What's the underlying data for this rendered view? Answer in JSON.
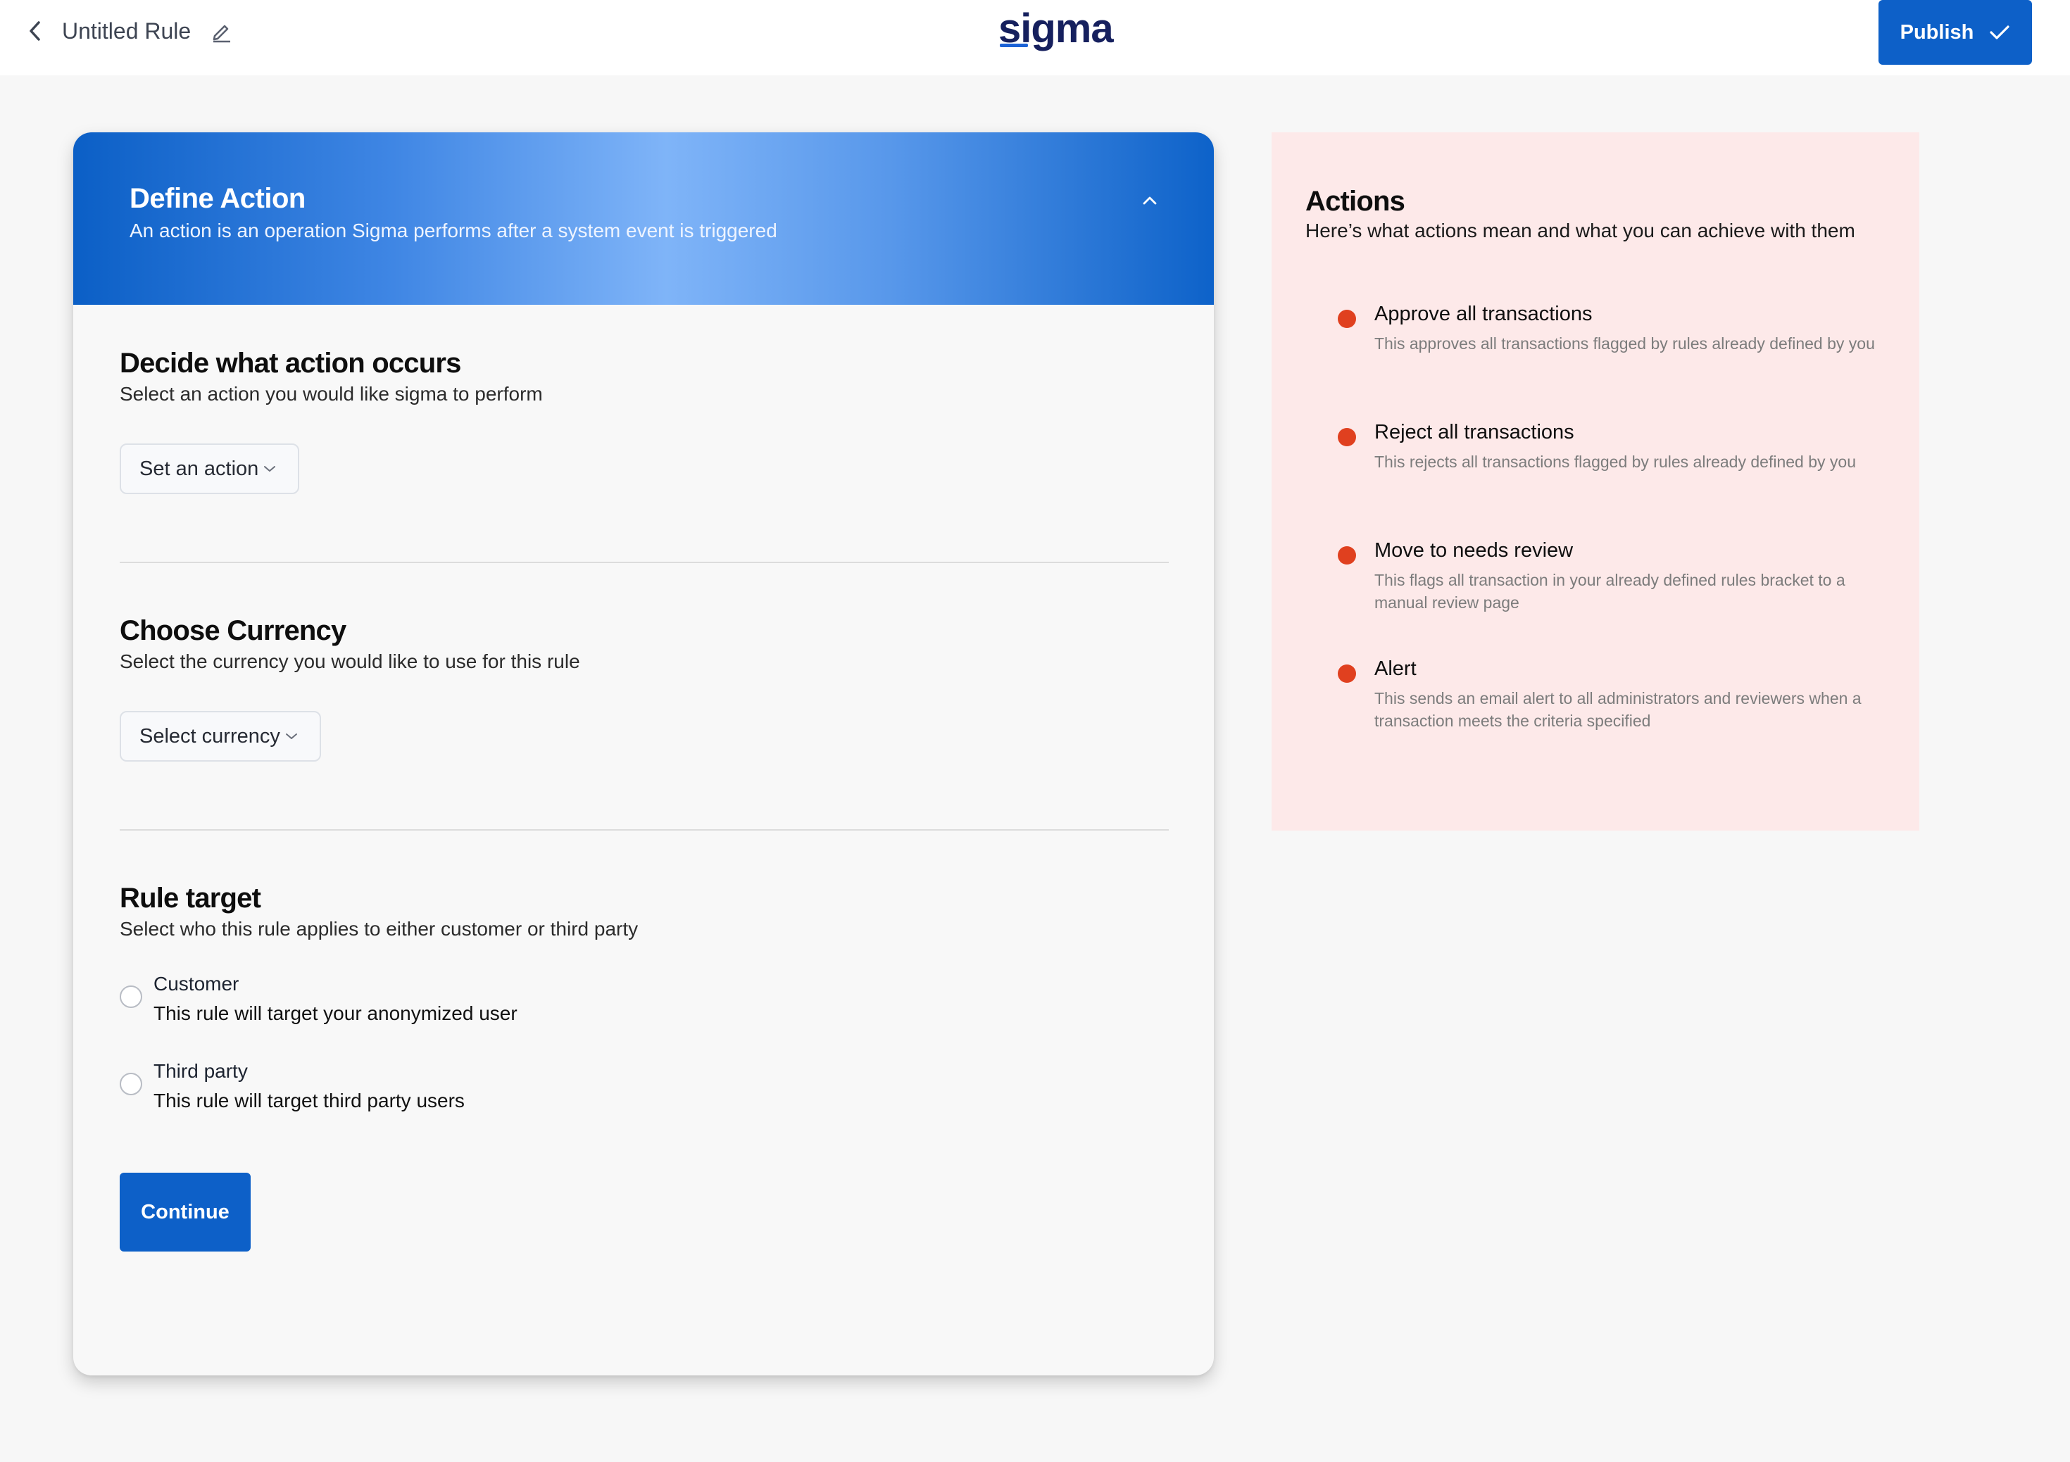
{
  "header": {
    "rule_title": "Untitled Rule",
    "logo_text": "sigma",
    "publish_label": "Publish"
  },
  "card": {
    "header_title": "Define Action",
    "header_subtitle": "An action is an operation Sigma performs after a system event is triggered",
    "action_section": {
      "title": "Decide what action occurs",
      "subtitle": "Select an action you would like sigma to perform",
      "dropdown_value": "Set an action"
    },
    "currency_section": {
      "title": "Choose Currency",
      "subtitle": "Select the currency you would like to use for this rule",
      "dropdown_value": "Select currency"
    },
    "target_section": {
      "title": "Rule target",
      "subtitle": "Select who this rule applies to either customer or third party",
      "options": [
        {
          "label": "Customer",
          "description": "This rule will target your anonymized user",
          "selected": false
        },
        {
          "label": "Third party",
          "description": "This rule will target third party users",
          "selected": false
        }
      ]
    },
    "continue_label": "Continue"
  },
  "info_panel": {
    "title": "Actions",
    "subtitle": "Here’s what actions mean and what you can achieve with them",
    "bullet_color": "#e0401f",
    "items": [
      {
        "title": "Approve all transactions",
        "description": "This approves all transactions flagged by rules already defined by you"
      },
      {
        "title": "Reject all transactions",
        "description": "This rejects all transactions flagged by rules already defined by you"
      },
      {
        "title": "Move to needs review",
        "description": "This flags all transaction in your already defined rules bracket to a manual review page"
      },
      {
        "title": "Alert",
        "description": "This sends an email alert to all administrators and reviewers when a transaction meets the criteria specified"
      }
    ]
  },
  "colors": {
    "primary": "#0d60c8",
    "info_background": "#fde9e9",
    "page_background": "#f7f7f7"
  }
}
